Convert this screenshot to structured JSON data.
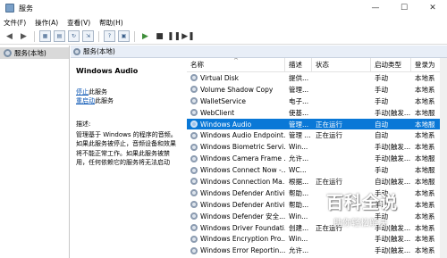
{
  "window": {
    "title": "服务",
    "minimize": "—",
    "maximize": "☐",
    "close": "✕"
  },
  "menu": [
    "文件(F)",
    "操作(A)",
    "查看(V)",
    "帮助(H)"
  ],
  "tree": {
    "item": "服务(本地)"
  },
  "content_header": "服务(本地)",
  "description_panel": {
    "title": "Windows Audio",
    "stop_link": "停止",
    "stop_suffix": "此服务",
    "restart_link": "重启动",
    "restart_suffix": "此服务",
    "desc_label": "描述:",
    "desc_lines": [
      "管理基于 Windows 的程序的音频。",
      "如果此服务被停止，音频设备和效果",
      "将不能正常工作。如果此服务被禁",
      "用，任何依赖它的服务将无法启动"
    ]
  },
  "columns": [
    "名称",
    "描述",
    "状态",
    "启动类型",
    "登录为"
  ],
  "services": [
    {
      "name": "Virtual Disk",
      "desc": "提供...",
      "status": "",
      "start": "手动",
      "login": "本地系"
    },
    {
      "name": "Volume Shadow Copy",
      "desc": "管理...",
      "status": "",
      "start": "手动",
      "login": "本地系"
    },
    {
      "name": "WalletService",
      "desc": "电子...",
      "status": "",
      "start": "手动",
      "login": "本地系"
    },
    {
      "name": "WebClient",
      "desc": "使基...",
      "status": "",
      "start": "手动(触发...",
      "login": "本地服"
    },
    {
      "name": "Windows Audio",
      "desc": "管理...",
      "status": "正在运行",
      "start": "自动",
      "login": "本地服",
      "selected": true
    },
    {
      "name": "Windows Audio Endpoint...",
      "desc": "管理 ...",
      "status": "正在运行",
      "start": "自动",
      "login": "本地系"
    },
    {
      "name": "Windows Biometric Servi...",
      "desc": "Win...",
      "status": "",
      "start": "手动(触发...",
      "login": "本地系"
    },
    {
      "name": "Windows Camera Frame ...",
      "desc": "允许...",
      "status": "",
      "start": "手动(触发...",
      "login": "本地服"
    },
    {
      "name": "Windows Connect Now -...",
      "desc": "WC...",
      "status": "",
      "start": "手动",
      "login": "本地服"
    },
    {
      "name": "Windows Connection Ma...",
      "desc": "根据...",
      "status": "正在运行",
      "start": "自动(触发...",
      "login": "本地服"
    },
    {
      "name": "Windows Defender Antivi...",
      "desc": "帮助...",
      "status": "",
      "start": "手动",
      "login": "本地系"
    },
    {
      "name": "Windows Defender Antivi...",
      "desc": "帮助...",
      "status": "",
      "start": "手动",
      "login": "本地系"
    },
    {
      "name": "Windows Defender 安全...",
      "desc": "Win...",
      "status": "",
      "start": "手动",
      "login": "本地系"
    },
    {
      "name": "Windows Driver Foundati...",
      "desc": "创建...",
      "status": "正在运行",
      "start": "手动(触发...",
      "login": "本地系"
    },
    {
      "name": "Windows Encryption Pro...",
      "desc": "Win...",
      "status": "",
      "start": "手动(触发...",
      "login": "本地系"
    },
    {
      "name": "Windows Error Reportin...",
      "desc": "允许...",
      "status": "",
      "start": "手动(触发...",
      "login": "本地系"
    }
  ],
  "watermark": {
    "main": "百科全说",
    "sub": "助你轻松解决"
  }
}
